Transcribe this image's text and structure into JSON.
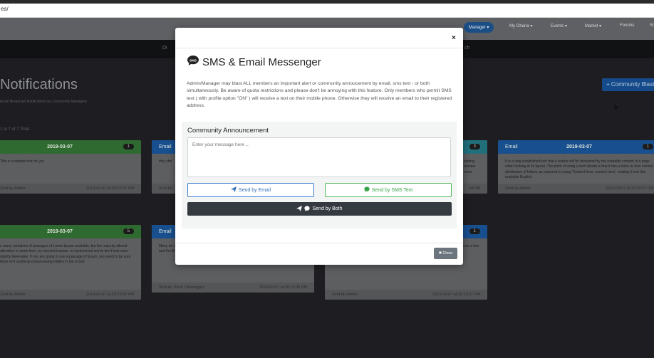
{
  "browser": {
    "url": "es/"
  },
  "navbar": {
    "items": [
      {
        "label": "Manager ▾",
        "active": true
      },
      {
        "label": "My Ohana ▾"
      },
      {
        "label": "Events ▾"
      },
      {
        "label": "Market ▾"
      },
      {
        "label": "Forums"
      },
      {
        "label": "Si"
      }
    ]
  },
  "subbar": {
    "left": "Di",
    "right": "ch"
  },
  "page": {
    "title": "Notifications",
    "subtitle": "Email Broadcast Notifications by Community Managers",
    "count": "1 to 7 of 7 Total",
    "blast_button": "+ Community Blast"
  },
  "cards": [
    {
      "color": "green",
      "type": "",
      "date": "2019-03-07",
      "badge": "1",
      "body": "This is a sample text for you",
      "sender": "Sent by Admin",
      "time": "2019-03-07 at 20:21:07 PM"
    },
    {
      "color": "blue",
      "type": "Email",
      "date": "",
      "badge": "",
      "body": "Hey chri",
      "sender": "Sent by",
      "time": ""
    },
    {
      "color": "teal",
      "type": "",
      "date": "",
      "badge": "3",
      "body": "setting, release orem",
      "sender": "",
      "time": "28 PM"
    },
    {
      "color": "blue",
      "type": "Email",
      "date": "2019-03-07",
      "badge": "1",
      "body": "It is a long established fact that a reader will be distracted by the readable content of a page when looking at its layout. The point of using Lorem Ipsum is that it has a more-or-less normal distribution of letters, as opposed to using 'Content here, content here', making it look like readable English.",
      "sender": "Sent by Admin",
      "time": "2019-03-07 at 20:20:07 PM"
    },
    {
      "color": "green",
      "type": "",
      "date": "2019-03-07",
      "badge": "5",
      "body": "e many variations of passages of Lorem Ipsum available, but the majority altered alteration in some form, by injected humour, or randomised words don't look even slightly believable. If you are going to use a passage of Ipsum, you need to be sure there isn't anything embarrassing hidden in the of text.",
      "sender": "Sent by Admin",
      "time": "2019-03-07 at 20:19:52 PM"
    },
    {
      "color": "blue",
      "type": "Email",
      "date": "",
      "badge": "",
      "body": "Many de ou their de model t sites still by accident, sometimes on purpose (injected humour and the like).",
      "sender": "Sent by Tra.A.I (Manager)",
      "time": "2019-03-07 at 20:19:35 PM"
    },
    {
      "color": "blue",
      "type": "",
      "date": "",
      "badge": "1",
      "body": "psum of book The first line of Lorem Ipsum, \"Lorem ipsum dolor sit amet..\", comes from a line in section 1.10.32.",
      "sender": "Sent by Admin",
      "time": "2019-03-07 at 20:19:21 PM"
    }
  ],
  "modal": {
    "close_glyph": "×",
    "title": "SMS & Email Messenger",
    "title_icon": "sms-chat-icon",
    "description": "Admin/Manager may blast ALL members an important alert or community annoucement by email, sms text - or both simultaneously. Be aware of quota restrictions and please don't be annoying with this feature. Only members who permit SMS text ( with profile option \"ON\" ) will receive a text on their mobile phone. Otherwise they will receive an email to their registered address.",
    "form_label": "Community Announcement",
    "message_placeholder": "Enter your message here ...",
    "message_value": "",
    "send_email_label": "Send by Email",
    "send_sms_label": "Send by SMS Text",
    "send_both_label": "Send by Both",
    "close_label": "Close",
    "colors": {
      "email": "#2f6fbe",
      "sms": "#38a447",
      "both": "#343a40",
      "close": "#6c757d"
    }
  }
}
